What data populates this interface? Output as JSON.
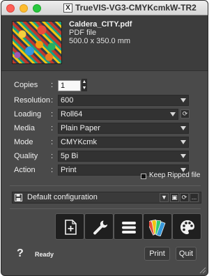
{
  "window": {
    "title": "TrueVIS-VG3-CMYKcmkW-TR2"
  },
  "file": {
    "name": "Caldera_CITY.pdf",
    "type": "PDF file",
    "dimensions": "500.0 x 350.0 mm"
  },
  "settings": {
    "colon": ":",
    "copies": {
      "label": "Copies",
      "value": "1"
    },
    "resolution": {
      "label": "Resolution",
      "value": "600"
    },
    "loading": {
      "label": "Loading",
      "value": "Roll64"
    },
    "media": {
      "label": "Media",
      "value": "Plain Paper"
    },
    "mode": {
      "label": "Mode",
      "value": "CMYKcmk"
    },
    "quality": {
      "label": "Quality",
      "value": "5p Bi"
    },
    "action": {
      "label": "Action",
      "value": "Print"
    }
  },
  "keep_ripped": {
    "label": "Keep Ripped file",
    "checked": false
  },
  "configuration": {
    "value": "Default configuration",
    "more_label": "..."
  },
  "toolbar": [
    {
      "name": "add-job-icon"
    },
    {
      "name": "wrench-icon"
    },
    {
      "name": "menu-icon"
    },
    {
      "name": "swatches-icon"
    },
    {
      "name": "palette-icon"
    }
  ],
  "footer": {
    "help": "?",
    "status": "Ready",
    "print_label": "Print",
    "quit_label": "Quit"
  }
}
